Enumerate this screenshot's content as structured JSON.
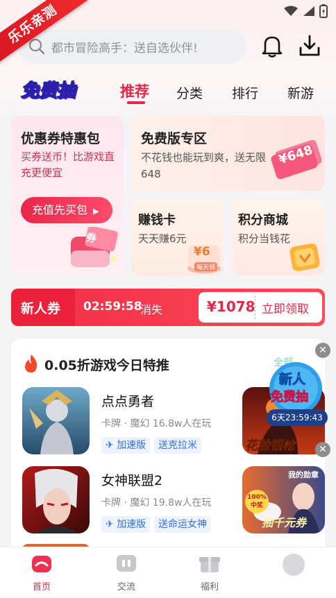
{
  "ribbon": {
    "text": "乐乐亲测"
  },
  "search": {
    "placeholder": "都市冒险高手：送自选伙伴!"
  },
  "header": {
    "free_draw_logo": "免费抽"
  },
  "tabs": [
    {
      "label": "推荐",
      "active": true
    },
    {
      "label": "分类"
    },
    {
      "label": "排行"
    },
    {
      "label": "新游"
    }
  ],
  "cards": {
    "coupon": {
      "title": "优惠券特惠包",
      "subtitle": "买券送币！比游戏直充更便宜",
      "button": "充值先买包",
      "badge": "券"
    },
    "free": {
      "title": "免费版专区",
      "subtitle": "不花钱也能玩到爽，送无限648",
      "ticket": "¥648"
    },
    "money": {
      "title": "赚钱卡",
      "subtitle": "天天赚6元",
      "coin": "¥6",
      "coin_sub": "每天领"
    },
    "points": {
      "title": "积分商城",
      "subtitle": "积分当钱花"
    }
  },
  "newcomer": {
    "label": "新人券",
    "timer": "02:59:58",
    "timer_suffix": "消失",
    "amount": "¥1078",
    "button": "立即领取"
  },
  "feed": {
    "title": "0.05折游戏今日特推",
    "more": "全部",
    "games": [
      {
        "name": "点点勇者",
        "meta": "卡牌 · 魔幻  16.8w人在玩",
        "tags": [
          "加速版",
          "送克拉米"
        ]
      },
      {
        "name": "女神联盟2",
        "meta": "卡牌 · 魔幻  19.8w人在玩",
        "tags": [
          "加速版",
          "送命运女神"
        ]
      }
    ],
    "side_games": [
      {
        "caption": "花脸银枪"
      },
      {
        "caption": "抽千元券",
        "badge": "100% 中奖",
        "top": "我的勋章"
      }
    ]
  },
  "floater": {
    "line1": "新人",
    "line2": "免费抽",
    "countdown": "6天23:59:43"
  },
  "bottom_nav": [
    {
      "label": "首页",
      "active": true
    },
    {
      "label": "交流"
    },
    {
      "label": "福利"
    },
    {
      "label": ""
    }
  ],
  "colors": {
    "accent": "#e8264a",
    "tag_blue": "#2f6ff0"
  }
}
